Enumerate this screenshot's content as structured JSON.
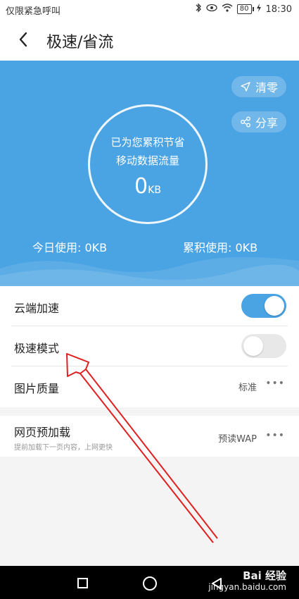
{
  "status_bar": {
    "carrier_text": "仅限紧急呼叫",
    "battery": "80",
    "time": "18:30"
  },
  "title_bar": {
    "title": "极速/省流"
  },
  "hero": {
    "clear_label": "清零",
    "share_label": "分享",
    "circle_line1": "已为您累积节省",
    "circle_line2": "移动数据流量",
    "saved_value": "0",
    "saved_unit": "KB",
    "today_usage": "今日使用: 0KB",
    "total_usage": "累积使用: 0KB"
  },
  "settings": {
    "cloud_accel": {
      "label": "云端加速",
      "enabled": true
    },
    "fast_mode": {
      "label": "极速模式",
      "enabled": false
    },
    "image_quality": {
      "label": "图片质量",
      "value": "标准",
      "more": "•••"
    }
  },
  "preload": {
    "label": "网页预加载",
    "description": "提前加载下一页内容，上网更快",
    "value": "预读WAP",
    "more": "•••"
  },
  "watermark": {
    "brand": "Bai 经验",
    "url": "jingyan.baidu.com"
  },
  "colors": {
    "accent": "#4aa3e3",
    "annotation": "#e02020"
  }
}
